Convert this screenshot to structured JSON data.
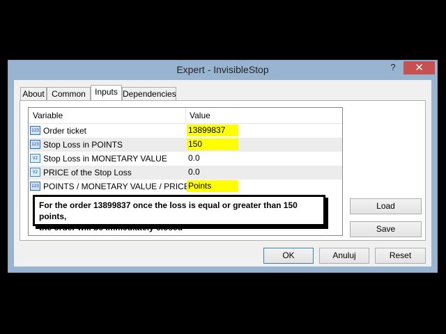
{
  "window": {
    "title": "Expert - InvisibleStop",
    "help_label": "?",
    "close_label": "✕"
  },
  "tabs": [
    {
      "label": "About"
    },
    {
      "label": "Common"
    },
    {
      "label": "Inputs"
    },
    {
      "label": "Dependencies"
    }
  ],
  "active_tab": "Inputs",
  "grid": {
    "headers": {
      "variable": "Variable",
      "value": "Value"
    },
    "rows": [
      {
        "icon": "123",
        "name": "Order ticket",
        "value": "13899837",
        "highlighted": true
      },
      {
        "icon": "123",
        "name": "Stop Loss in POINTS",
        "value": "150",
        "highlighted": true
      },
      {
        "icon": "V2",
        "name": "Stop Loss in MONETARY VALUE",
        "value": "0.0",
        "highlighted": false
      },
      {
        "icon": "V2",
        "name": "PRICE of the Stop Loss",
        "value": "0.0",
        "highlighted": false
      },
      {
        "icon": "123",
        "name": "POINTS / MONETARY VALUE / PRICE",
        "value": "Points",
        "highlighted": true
      }
    ]
  },
  "note": {
    "line1": "For the order 13899837 once the loss is equal or greater than 150 points,",
    "line2": "the order will be immediately closed"
  },
  "buttons": {
    "load": "Load",
    "save": "Save",
    "ok": "OK",
    "cancel": "Anuluj",
    "reset": "Reset"
  },
  "colors": {
    "titlebar": "#99b4d1",
    "close": "#c75050",
    "highlight": "#ffff00",
    "dialog_bg": "#f0f0f0"
  }
}
